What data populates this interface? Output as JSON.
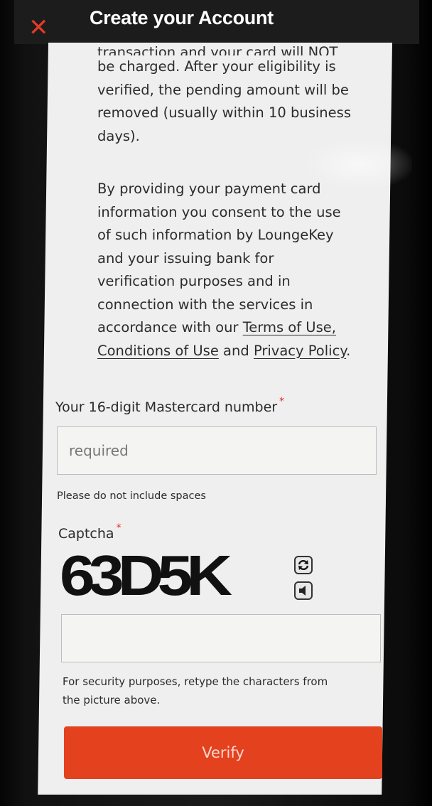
{
  "header": {
    "title": "Create your Account",
    "close_icon": "close-icon",
    "close_glyph": "✕"
  },
  "body": {
    "p1_cut_line": "transaction and your card will NOT",
    "p1_lines": [
      "be charged. After your eligibility is",
      "verified, the pending amount will be",
      "removed (usually within 10 business",
      "days)."
    ],
    "p2_lines": [
      "By providing your payment card",
      "information you consent to the use",
      "of such information by LoungeKey",
      "and your issuing bank for",
      "verification purposes and in",
      "connection with the services in",
      "accordance with our "
    ],
    "terms_link": "Terms of Use,",
    "conditions_link": "Conditions of Use",
    "and_text": " and ",
    "privacy_link": "Privacy Policy",
    "period": "."
  },
  "form": {
    "card_label": "Your 16-digit Mastercard number",
    "required_mark": "*",
    "card_placeholder": "required",
    "card_hint": "Please do not include spaces",
    "captcha_label": "Captcha",
    "captcha_text": "63D5K",
    "captcha_hint_lines": [
      "For security purposes, retype the characters from",
      "the picture above."
    ],
    "verify_label": "Verify"
  },
  "colors": {
    "accent": "#e4411f",
    "required": "#e3301e",
    "background": "#eeefee"
  }
}
